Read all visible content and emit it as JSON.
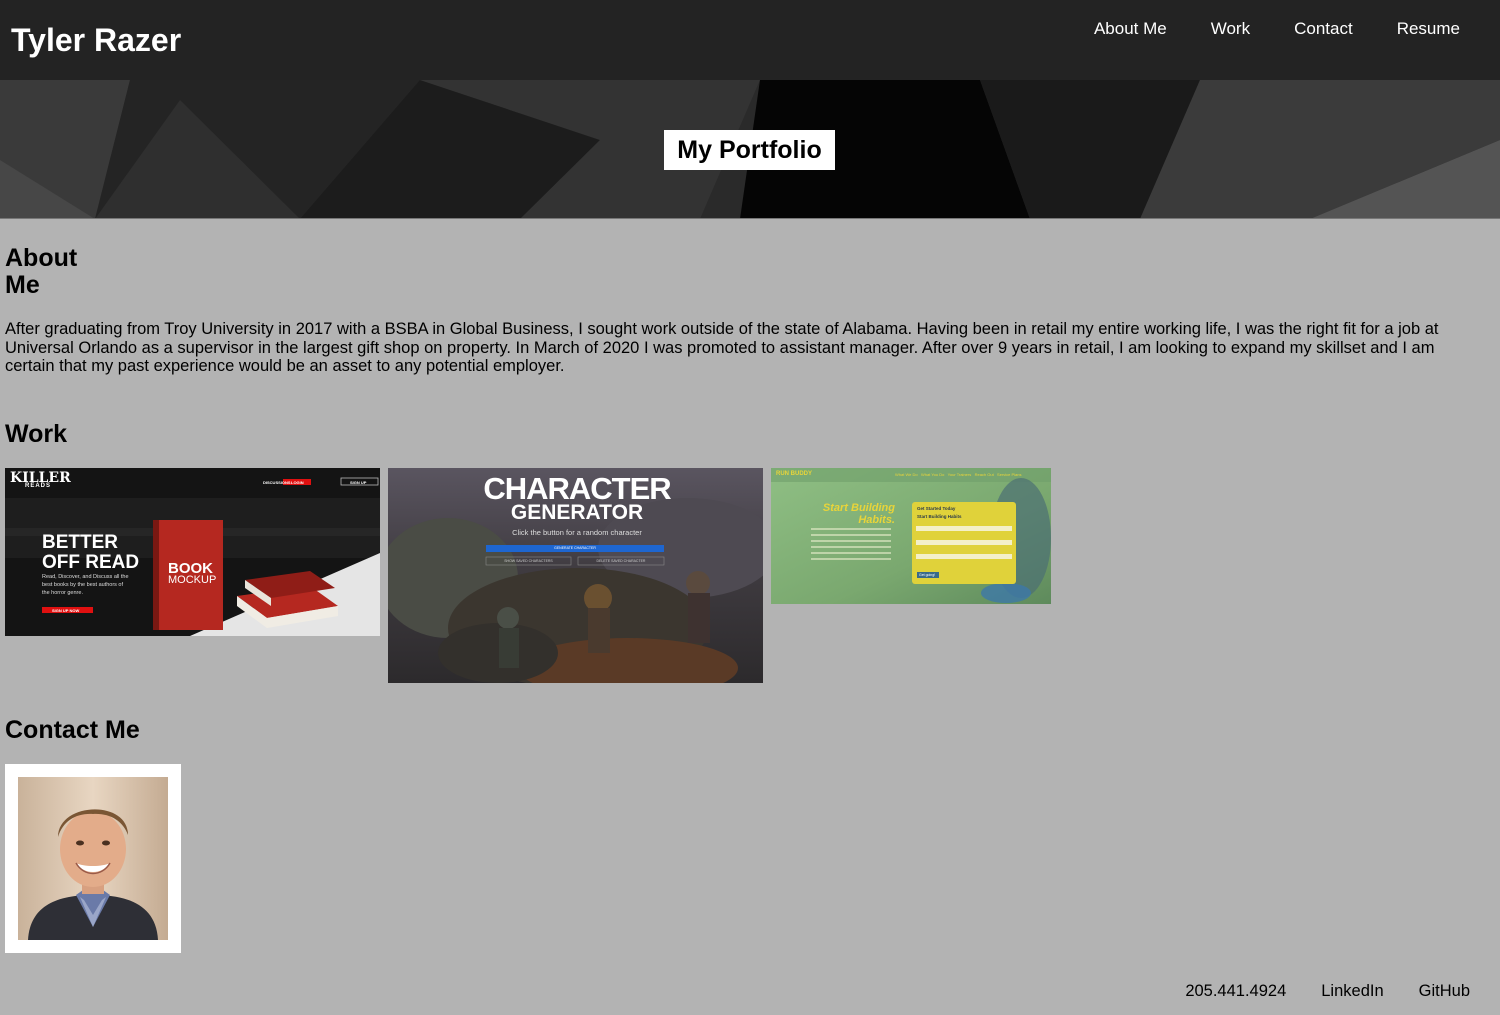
{
  "header": {
    "brand": "Tyler Razer",
    "nav": [
      "About Me",
      "Work",
      "Contact",
      "Resume"
    ]
  },
  "hero": {
    "title": "My Portfolio"
  },
  "about": {
    "heading": "About Me",
    "text": "After graduating from Troy University in 2017 with a BSBA in Global Business, I sought work outside of the state of Alabama. Having been in retail my entire working life, I was the right fit for a job at Universal Orlando as a supervisor in the largest gift shop on property. In March of 2020 I was promoted to assistant manager. After over 9 years in retail, I am looking to expand my skillset and I am certain that my past experience would be an asset to any potential employer."
  },
  "work": {
    "heading": "Work",
    "projects": [
      {
        "name": "Killer Reads",
        "logo_top": "KILLER",
        "logo_bottom": "READS",
        "nav": [
          "DISCUSSIONS",
          "LOGIN",
          "SIGN UP"
        ],
        "headline_1": "BETTER",
        "headline_2": "OFF READ",
        "tagline_1": "Read, Discover, and Discuss all the",
        "tagline_2": "best books by the best authors of",
        "tagline_3": "the horror genre.",
        "cta": "SIGN UP NOW",
        "book_1": "BOOK",
        "book_2": "MOCKUP"
      },
      {
        "name": "Character Generator",
        "title_1": "CHARACTER",
        "title_2": "GENERATOR",
        "subtitle": "Click the button for a random character",
        "btn_generate": "GENERATE CHARACTER",
        "btn_show": "SHOW SAVED CHARACTERS",
        "btn_delete": "DELETE SAVED CHARACTER"
      },
      {
        "name": "Run Buddy",
        "logo": "RUN BUDDY",
        "nav": [
          "What We Do",
          "What You Do",
          "Your Trainers",
          "Reach Out",
          "Service Plans"
        ],
        "headline_1": "Start Building",
        "headline_2": "Habits.",
        "form_title_1": "Get Started Today",
        "form_title_2": "Start Building Habits",
        "submit": "Get going!"
      }
    ]
  },
  "contact": {
    "heading": "Contact Me"
  },
  "footer": {
    "links": [
      "205.441.4924",
      "LinkedIn",
      "GitHub"
    ]
  },
  "colors": {
    "header_bg": "#232323",
    "page_bg": "#b3b3b3",
    "accent_red": "#e01010",
    "accent_blue": "#1e66d0"
  }
}
